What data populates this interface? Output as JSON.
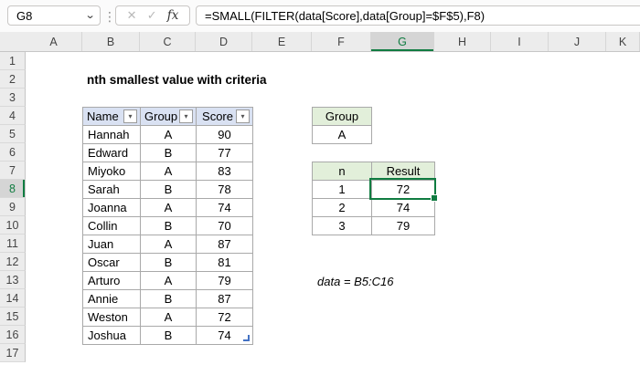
{
  "formula_bar": {
    "name_box_value": "G8",
    "formula": "=SMALL(FILTER(data[Score],data[Group]=$F$5),F8)",
    "icons": {
      "dropdown": "⌄",
      "dots": "⋮",
      "cancel": "✕",
      "check": "✓",
      "fx": "fx",
      "filter": "▾"
    }
  },
  "grid": {
    "column_headers": [
      "A",
      "B",
      "C",
      "D",
      "E",
      "F",
      "G",
      "H",
      "I",
      "J",
      "K"
    ],
    "row_headers": [
      "1",
      "2",
      "3",
      "4",
      "5",
      "6",
      "7",
      "8",
      "9",
      "10",
      "11",
      "12",
      "13",
      "14",
      "15",
      "16",
      "17"
    ],
    "selected_column": "G",
    "selected_row": "8",
    "selected_cell": "G8"
  },
  "content": {
    "title": "nth smallest value with criteria",
    "data_table": {
      "headers": [
        "Name",
        "Group",
        "Score"
      ],
      "rows": [
        [
          "Hannah",
          "A",
          "90"
        ],
        [
          "Edward",
          "B",
          "77"
        ],
        [
          "Miyoko",
          "A",
          "83"
        ],
        [
          "Sarah",
          "B",
          "78"
        ],
        [
          "Joanna",
          "A",
          "74"
        ],
        [
          "Collin",
          "B",
          "70"
        ],
        [
          "Juan",
          "A",
          "87"
        ],
        [
          "Oscar",
          "B",
          "81"
        ],
        [
          "Arturo",
          "A",
          "79"
        ],
        [
          "Annie",
          "B",
          "87"
        ],
        [
          "Weston",
          "A",
          "72"
        ],
        [
          "Joshua",
          "B",
          "74"
        ]
      ]
    },
    "criteria": {
      "header": "Group",
      "value": "A"
    },
    "results": {
      "headers": [
        "n",
        "Result"
      ],
      "rows": [
        [
          "1",
          "72"
        ],
        [
          "2",
          "74"
        ],
        [
          "3",
          "79"
        ]
      ],
      "selected_value": "72"
    },
    "annotation": "data = B5:C16"
  },
  "colors": {
    "accent_green": "#107C41",
    "table_header_fill": "#D9E1F2",
    "mini_header_fill": "#E2EFDA",
    "selection_border": "#107C41",
    "resize_handle_blue": "#4472C4"
  }
}
